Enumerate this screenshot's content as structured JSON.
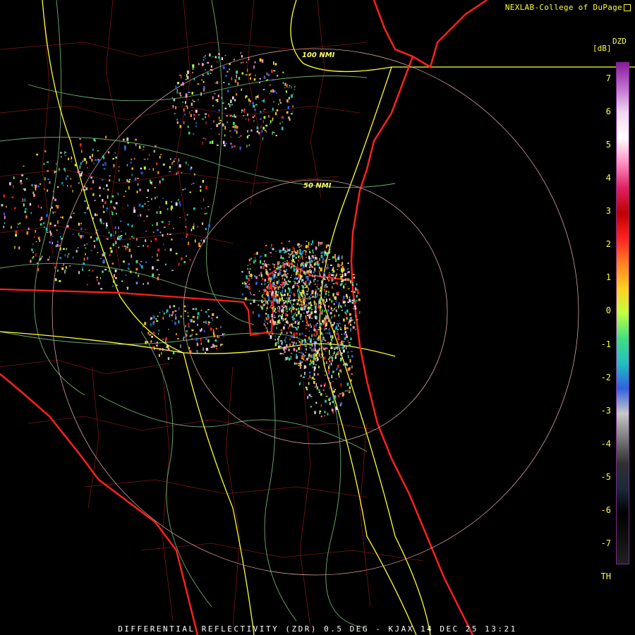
{
  "credit": "NEXLAB-College of DuPage",
  "product_label": "DZD",
  "unit_label": "[dB]",
  "range_labels": {
    "outer": "100 NMI",
    "inner": "50 NMI"
  },
  "legend_ticks": [
    "7",
    "6",
    "5",
    "4",
    "3",
    "2",
    "1",
    "0",
    "-1",
    "-2",
    "-3",
    "-4",
    "-5",
    "-6",
    "-7",
    "TH"
  ],
  "footer": "DIFFERENTIAL REFLECTIVITY (ZDR) 0.5 DEG - KJAX 14 DEC 25 13:21",
  "colors": {
    "background": "#000000",
    "coastline": "#ff1a1a",
    "county_lines": "#8b1a1a",
    "highways": "#ffff33",
    "roads": "#7fbf7f",
    "range_rings": "#d8a0a0",
    "text": "#ffff33"
  },
  "colorbar_stops": [
    "#8a1a9a",
    "#c070d0",
    "#f0d8f0",
    "#ffffff",
    "#ff90c0",
    "#e02060",
    "#c00000",
    "#ff2020",
    "#ff8020",
    "#ffd020",
    "#c0ff40",
    "#40e080",
    "#20c0c0",
    "#3060e0",
    "#c8c8c8",
    "#7a7a7a",
    "#303030",
    "#1a2a3a",
    "#000000",
    "#101010",
    "#202020"
  ]
}
